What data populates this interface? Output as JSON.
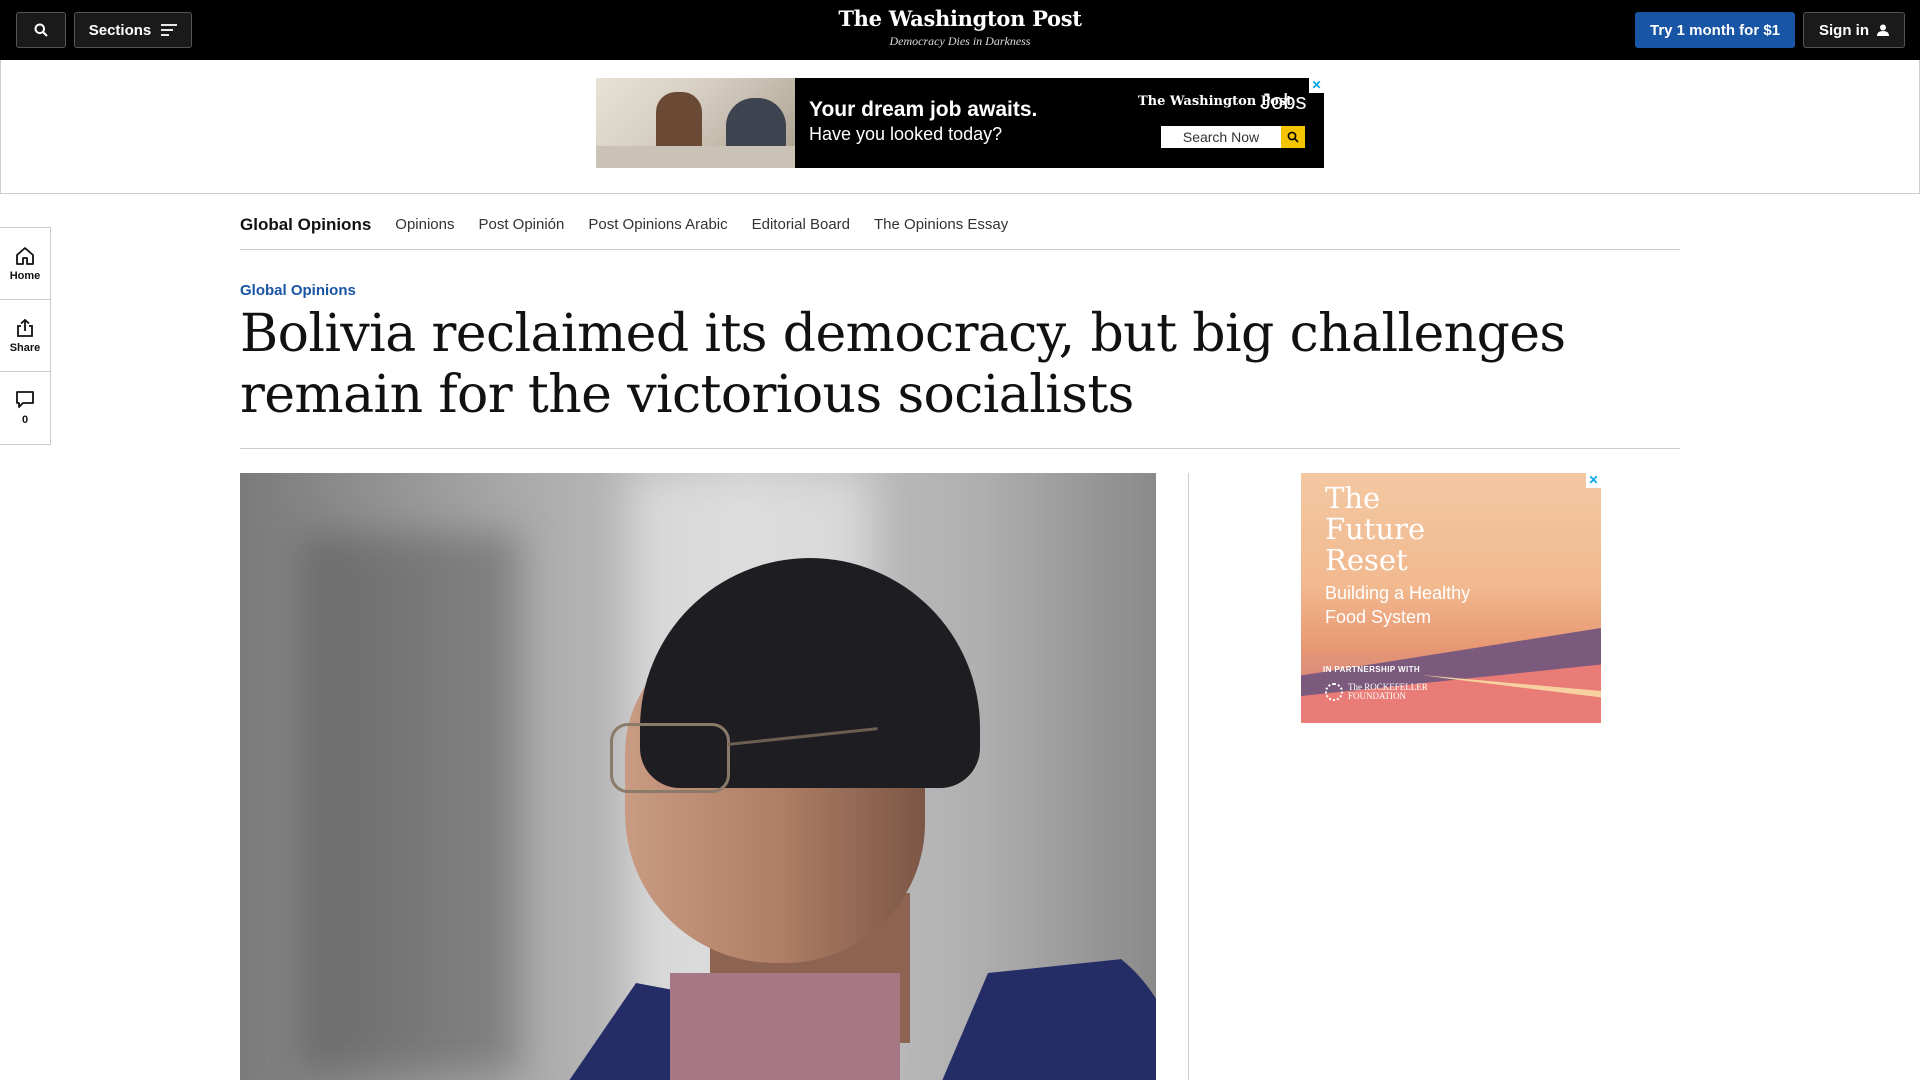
{
  "header": {
    "sections_label": "Sections",
    "logo": "The Washington Post",
    "tagline": "Democracy Dies in Darkness",
    "subscribe_label": "Try 1 month for $1",
    "signin_label": "Sign in"
  },
  "top_ad": {
    "headline": "Your dream job awaits.",
    "subline": "Have you looked today?",
    "brand": "The Washington Post",
    "product": "Jobs",
    "search_label": "Search Now",
    "close": "✕"
  },
  "subnav": {
    "active": "Global Opinions",
    "items": [
      "Opinions",
      "Post Opinión",
      "Post Opinions Arabic",
      "Editorial Board",
      "The Opinions Essay"
    ]
  },
  "rail": {
    "home": "Home",
    "share": "Share",
    "comments": "0"
  },
  "article": {
    "kicker": "Global Opinions",
    "headline": "Bolivia reclaimed its democracy, but big challenges remain for the victorious socialists"
  },
  "side_ad": {
    "title": "The Future Reset",
    "subtitle": "Building a Healthy Food System",
    "partnership": "IN PARTNERSHIP WITH",
    "foundation": "The ROCKEFELLER FOUNDATION",
    "close": "✕"
  },
  "colors": {
    "accent": "#1955a5",
    "topbar": "#000000"
  }
}
